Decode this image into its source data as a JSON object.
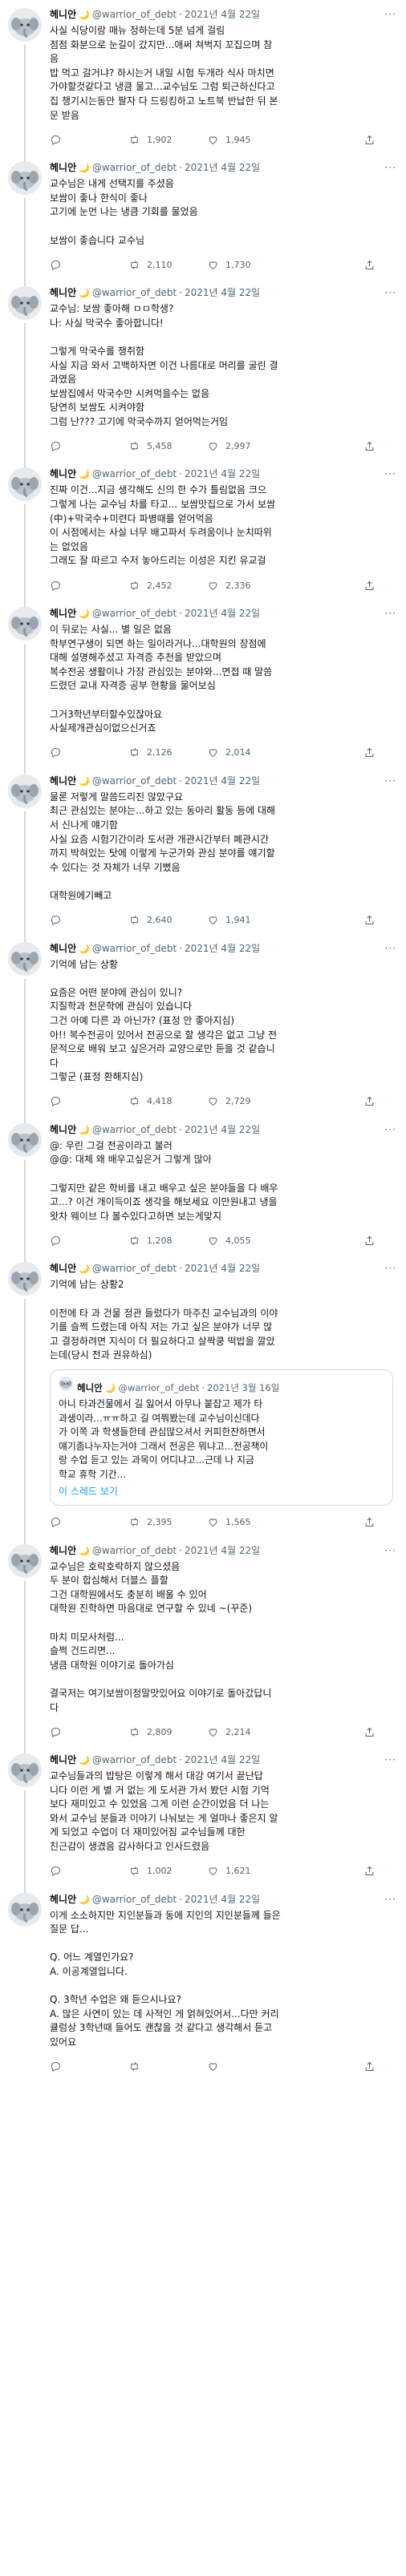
{
  "tweets": [
    {
      "name": "헤니안",
      "badge": "🌙",
      "handle": "@warrior_of_debt",
      "date": "2021년 4월 22일",
      "lines": [
        "사실 식당이랑 매뉴 정하는데 5분 넘게 걸림",
        "점점 화분으로 눈길이 갔지만...애써 쳐벅지 꼬집으며 참",
        "음",
        "밥 먹고 갈거냐? 하시는거 내일 시험 두개라 식사 마치면",
        "가야할것같다고 냉큼 물고...교수님도 그럼 퇴근하신다고",
        "집 챙기시는동안 팔자 다 드링킹하고 노트북 반납한 뒤 본",
        "문 받음"
      ],
      "replies": "",
      "retweets": "1,902",
      "likes": "1,945"
    },
    {
      "name": "헤니안",
      "badge": "🌙",
      "handle": "@warrior_of_debt",
      "date": "2021년 4월 22일",
      "lines": [
        "교수님은 내게 선택지를 주셨음",
        "보쌈이 좋나 한식이 좋나",
        "고기에 눈먼 나는 냉큼 기회를 물었음",
        "",
        "보쌈이 좋습니다 교수님"
      ],
      "replies": "",
      "retweets": "2,110",
      "likes": "1,730"
    },
    {
      "name": "헤니안",
      "badge": "🌙",
      "handle": "@warrior_of_debt",
      "date": "2021년 4월 22일",
      "lines": [
        "교수님: 보쌈 좋아해 ㅁㅁ학생?",
        "나: 사실 막국수 좋아합니다!",
        "",
        "그렇게 막국수를 쟁취함",
        "사실 지금 와서 고백하자면 이건 나름대로 머리를 굴린 결",
        "과였음",
        "보쌈집에서 막국수만 시켜먹을수는 없음",
        "당연히 보쌈도 시켜야함",
        "그럼 난??? 고기에 막국수까지 얻어먹는거임"
      ],
      "replies": "",
      "retweets": "5,458",
      "likes": "2,997"
    },
    {
      "name": "헤니안",
      "badge": "🌙",
      "handle": "@warrior_of_debt",
      "date": "2021년 4월 22일",
      "lines": [
        "진짜 이건...지금 생각해도 신의 한 수가 틀림없음 크으",
        "그렇게 나는 교수님 차를 타고... 보쌈맛집으로 가서 보쌈",
        "(中)+막국수+미련다 파병때를 얻어먹음",
        "이 시점에서는 사실 너무 배고파서 두려움이나 눈치따위",
        "는 없었음",
        "그래도 잘 따르고 수저 놓아드리는 이성은 지킨 유교걸"
      ],
      "replies": "",
      "retweets": "2,452",
      "likes": "2,336"
    },
    {
      "name": "헤니안",
      "badge": "🌙",
      "handle": "@warrior_of_debt",
      "date": "2021년 4월 22일",
      "lines": [
        "이 뒤로는 사실... 별 일은 없음",
        "학부연구생이 되면 하는 일이라거나...대학원의 장점에",
        "대해 설명해주셨고 자격증 추천을 받았으며",
        "복수전공 생활이나 가장 관심있는 분야와...면접 때 말씀",
        "드렸던 교내 자격증 공부 현황을 물어보심",
        "",
        "그거3학년부터할수있잖아요",
        "사실제개관심이없으신거죠"
      ],
      "replies": "",
      "retweets": "2,126",
      "likes": "2,014"
    },
    {
      "name": "헤니안",
      "badge": "🌙",
      "handle": "@warrior_of_debt",
      "date": "2021년 4월 22일",
      "lines": [
        "물론 저렇게 말씀드리진 않았구요",
        "최근 관심있는 분야는...하고 있는 동아리 활동 등에 대해",
        "서 신나게 얘기함",
        "사실 요즘 시험기간이라 도서관 개관시간부터 폐관시간",
        "까지 박혀있는 탓에 이렇게 누군가와 관심 분야를 얘기할",
        "수 있다는 것 자체가 너무 기뻤음",
        "",
        "대학원에기빼고"
      ],
      "replies": "",
      "retweets": "2,640",
      "likes": "1,941"
    },
    {
      "name": "헤니안",
      "badge": "🌙",
      "handle": "@warrior_of_debt",
      "date": "2021년 4월 22일",
      "lines": [
        "기억에 남는 상황",
        "",
        "요즘은 어떤 분야에 관심이 있니?",
        "지질학과 천문학에 관심이 있습니다",
        "그건 아예 다른 과 아닌가? (표정 안 좋아지심)",
        "아!! 복수전공이 있어서 전공으로 할 생각은 없고 그냥 전",
        "문적으로 배워 보고 싶은거라 교양으로만 듣을 것 같습니",
        "다",
        "그렇군 (표정 환해지심)"
      ],
      "replies": "",
      "retweets": "4,418",
      "likes": "2,729"
    },
    {
      "name": "헤니안",
      "badge": "🌙",
      "handle": "@warrior_of_debt",
      "date": "2021년 4월 22일",
      "lines": [
        "@: 우린 그걸 전공이라고 불러",
        "@@: 대체 왜 배우고싶은거 그렇게 많아",
        "",
        "그렇지만 같은 학비를 내고 배우고 싶은 분야들을 다 배우",
        "고...? 이건 개이득이죠 생각을 해보세요 이만원내고 냉을",
        "왓차 웨이브 다 볼수있다고하면 보는게맞지"
      ],
      "replies": "",
      "retweets": "1,208",
      "likes": "4,055"
    },
    {
      "name": "헤니안",
      "badge": "🌙",
      "handle": "@warrior_of_debt",
      "date": "2021년 4월 22일",
      "lines": [
        "기억에 남는 상황2",
        "",
        "이전에 타 과 건물 정관 들렀다가 마주친 교수님과의 이야",
        "기를 슬쩍 드렸는데 아직 저는 가고 싶은 분야가 너무 많",
        "고 결정하려면 지식이 더 필요하다고 살짝쿵 떡밥을 깔았",
        "는데(당시 전과 권유하심)"
      ],
      "quote": {
        "name": "헤니안",
        "badge": "🌙",
        "handle": "@warrior_of_debt",
        "date": "2021년 3월 16일",
        "lines": [
          "아니 타과건물에서 길 잃어서 아무나 붙잡고 제가 타",
          "과생이라...ㅠㅠ하고 길 여쭤봤는데 교수님이신데다",
          "가 이쪽 과 학생들한테 관심많으셔서 커피한잔하면서",
          "얘기좀나누자는거야 그래서 전공은 뭐냐고...전공책이",
          "랑 수업 듣고 있는 과목이 어디냐고...근데 나 지금",
          "학교 휴학 기간..."
        ],
        "thread_link": "이 스레드 보기"
      },
      "replies": "",
      "retweets": "2,395",
      "likes": "1,565"
    },
    {
      "name": "헤니안",
      "badge": "🌙",
      "handle": "@warrior_of_debt",
      "date": "2021년 4월 22일",
      "lines": [
        "교수님은 호락호락하지 않으셨음",
        "두 분이 합심해서 더블스 플할",
        "그건 대학원에서도 충분히 배울 수 있어",
        "대학원 진학하면 마음대로 연구할 수 있네 ~(꾸준)",
        "",
        "마치 미모사처럼...",
        "슬쩍 건드리면...",
        "냉큼 대학원 이야기로 돌아가심",
        "",
        "결국저는 여기보쌈이정말맛있어요 이야기로 돌아갔답니",
        "다"
      ],
      "replies": "",
      "retweets": "2,809",
      "likes": "2,214"
    },
    {
      "name": "헤니안",
      "badge": "🌙",
      "handle": "@warrior_of_debt",
      "date": "2021년 4월 22일",
      "lines": [
        "교수님들과의 밥탕은 이렇게 해서 대강 여기서 끝난답",
        "니다 이런 게 별 거 없는 게 도서관 가서 봤던 시험 기억",
        "보다 재미있고 수 있었음 그게 이런 순간이었음 더 나는",
        "와서 교수님 분들과 이야기 나눠보는 게 얼마나 좋은지 알",
        "게 되었고 수업이 더 재미있어짐 교수님들께 대한",
        "친근감이 생겼음 감사하다고 인사드렸음"
      ],
      "replies": "",
      "retweets": "1,002",
      "likes": "1,621"
    },
    {
      "name": "헤니안",
      "badge": "🌙",
      "handle": "@warrior_of_debt",
      "date": "2021년 4월 22일",
      "lines": [
        "이게 소소하지만 지인분들과 동에 지인의 지인분들께 들은",
        "질문 답...",
        "",
        "Q. 어느 계열인가요?",
        "A. 이공계열입니다.",
        "",
        "Q. 3학년 수업은 왜 듣으시나요?",
        "A. 많은 사연이 있는 데 사적인 게 얽혀있어서...다만 커리",
        "큘럼상 3학년때 들어도 괜찮을 것 같다고 생각해서 듣고",
        "있어요"
      ],
      "replies": "",
      "retweets": "",
      "likes": ""
    }
  ]
}
